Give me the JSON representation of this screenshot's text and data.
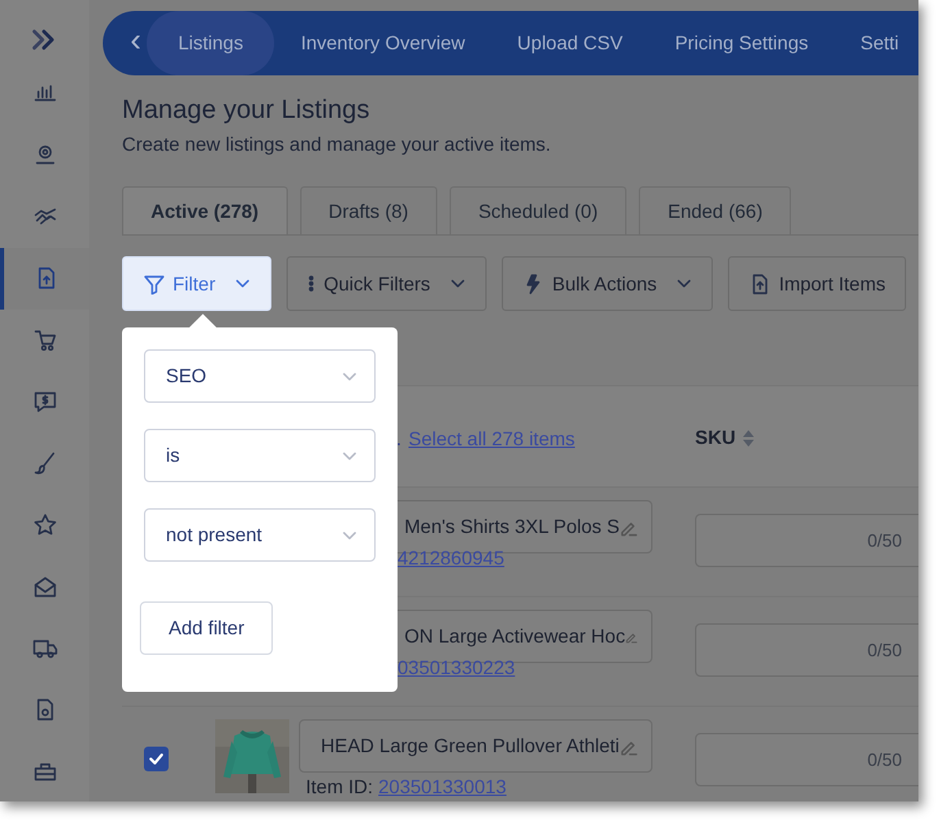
{
  "sidebar": {
    "items": [
      {
        "selected": false
      },
      {
        "selected": false
      },
      {
        "selected": false
      },
      {
        "selected": true
      },
      {
        "selected": false
      },
      {
        "selected": false
      },
      {
        "selected": false
      },
      {
        "selected": false
      },
      {
        "selected": false
      },
      {
        "selected": false
      },
      {
        "selected": false
      },
      {
        "selected": false
      }
    ]
  },
  "nav": {
    "back": "‹",
    "tabs": [
      {
        "label": "Listings",
        "selected": true
      },
      {
        "label": "Inventory Overview",
        "selected": false
      },
      {
        "label": "Upload CSV",
        "selected": false
      },
      {
        "label": "Pricing Settings",
        "selected": false
      },
      {
        "label": "Setti",
        "selected": false
      }
    ]
  },
  "header": {
    "title": "Manage your Listings",
    "subtitle": "Create new listings and manage your active items."
  },
  "status_tabs": [
    {
      "label": "Active (278)",
      "selected": true
    },
    {
      "label": "Drafts (8)",
      "selected": false
    },
    {
      "label": "Scheduled (0)",
      "selected": false
    },
    {
      "label": "Ended (66)",
      "selected": false
    }
  ],
  "toolbar": [
    {
      "label": "Filter",
      "kind": "filter",
      "expanded": true
    },
    {
      "label": "Quick Filters",
      "kind": "quick",
      "expanded": false
    },
    {
      "label": "Bulk Actions",
      "kind": "bulk",
      "expanded": false
    },
    {
      "label": "Import Items",
      "kind": "import"
    }
  ],
  "filter_popup": {
    "fields": [
      {
        "value": "SEO"
      },
      {
        "value": "is"
      },
      {
        "value": "not present"
      }
    ],
    "add_button": "Add filter"
  },
  "table": {
    "select_prefix": ".",
    "select_all": "Select all 278 items",
    "columns": [
      {
        "label": "SKU",
        "sortable": true
      }
    ],
    "rows": [
      {
        "title": "Men's Shirts 3XL Polos S",
        "item_id": "4212860945",
        "sku_counter": "0/50"
      },
      {
        "title": "ON Large Activewear Hoc",
        "item_id": "03501330223",
        "sku_counter": "0/50"
      },
      {
        "title": "HEAD Large Green Pullover Athleti",
        "item_id_label": "Item ID:",
        "item_id": "203501330013",
        "sku_counter": "0/50",
        "checked": true,
        "kind": "picture"
      }
    ]
  }
}
